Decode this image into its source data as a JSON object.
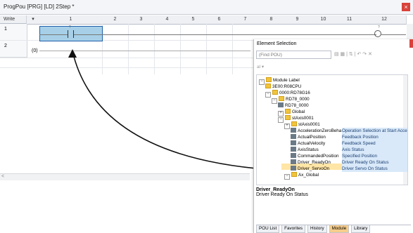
{
  "titlebar": {
    "title": "ProgPou [PRG] [LD] 2Step *",
    "close": "×"
  },
  "grid": {
    "write_label": "Write",
    "dropdown_symbol": "▾",
    "columns": [
      "1",
      "2",
      "3",
      "4",
      "5",
      "6",
      "7",
      "8",
      "9",
      "10",
      "11",
      "12"
    ],
    "row1": "1",
    "row2": "2",
    "row2_step": "(0)",
    "row_marker": "?",
    "left_arrow": "<"
  },
  "element_selection": {
    "title": "Element Selection",
    "close": "×",
    "search_placeholder": "(Find POU)",
    "subtool": "al ▾",
    "tree": [
      {
        "label": "Module Label",
        "indent": 0,
        "type": "root",
        "expander": "⊟"
      },
      {
        "label": "3E00:R08CPU",
        "indent": 1,
        "type": "folder"
      },
      {
        "label": "0000:RD78G16",
        "indent": 1,
        "type": "folder",
        "expander": "⊟"
      },
      {
        "label": "RD78_0000",
        "indent": 2,
        "type": "folder",
        "expander": "⊟"
      },
      {
        "label": "RD78_0000",
        "indent": 3,
        "type": "label"
      },
      {
        "label": "Global",
        "indent": 3,
        "type": "folder",
        "expander": "⊞"
      },
      {
        "label": "stAxis0001",
        "indent": 3,
        "type": "folder",
        "expander": "⊟"
      },
      {
        "label": "stAxis0001",
        "indent": 4,
        "type": "folder",
        "expander": "⊞"
      },
      {
        "label": "AccelerationZeroBeha",
        "indent": 5,
        "type": "label",
        "desc": "Operation Selection at Start Accelera"
      },
      {
        "label": "ActualPosition",
        "indent": 5,
        "type": "label",
        "desc": "Feedback Position"
      },
      {
        "label": "ActualVelocity",
        "indent": 5,
        "type": "label",
        "desc": "Feedback Speed"
      },
      {
        "label": "AxisStatus",
        "indent": 5,
        "type": "label",
        "desc": "Axis Status"
      },
      {
        "label": "CommandedPosition",
        "indent": 5,
        "type": "label",
        "desc": "Specified Position"
      },
      {
        "label": "Driver_ReadyOn",
        "indent": 5,
        "type": "label",
        "desc": "Driver Ready On Status"
      },
      {
        "label": "Driver_ServoOn",
        "indent": 5,
        "type": "label",
        "desc": "Driver Servo On Status"
      },
      {
        "label": "Ax_Global",
        "indent": 4,
        "type": "folder",
        "expander": "⊟"
      }
    ],
    "selected_label": "Driver_ReadyOn",
    "selected_desc": "Driver Ready On Status",
    "tabs": [
      "POU List",
      "Favorites",
      "History",
      "Module",
      "Library"
    ],
    "active_tab": "Module"
  },
  "colors": {
    "accent": "#1f5fa8",
    "selected_cell": "#a7d0e8",
    "highlight": "#ffe5a6",
    "close": "#d9423a"
  }
}
